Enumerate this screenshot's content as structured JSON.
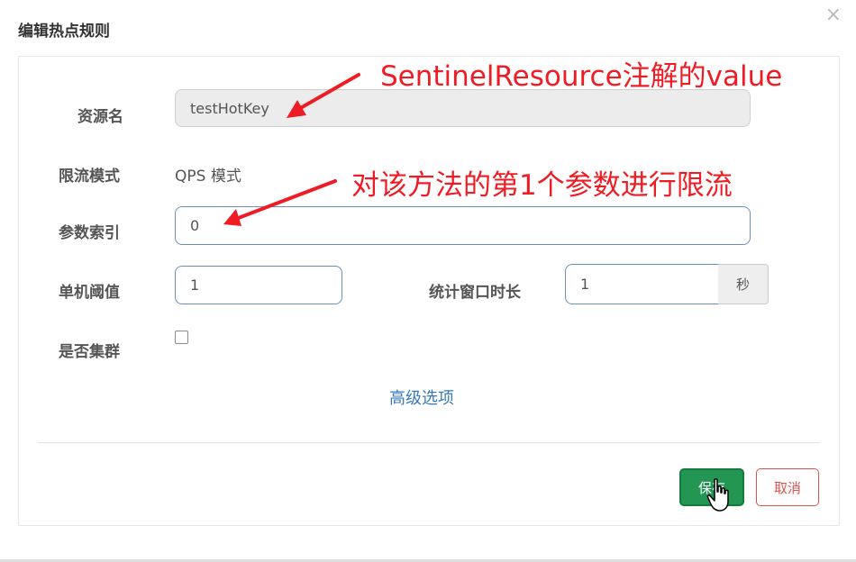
{
  "dialog": {
    "title": "编辑热点规则",
    "close_icon": "close-icon"
  },
  "form": {
    "resource_name": {
      "label": "资源名",
      "value": "testHotKey"
    },
    "limit_mode": {
      "label": "限流模式",
      "value": "QPS 模式"
    },
    "param_index": {
      "label": "参数索引",
      "value": "0"
    },
    "threshold": {
      "label": "单机阈值",
      "value": "1"
    },
    "window": {
      "label": "统计窗口时长",
      "value": "1",
      "unit": "秒"
    },
    "cluster": {
      "label": "是否集群",
      "checked": false
    },
    "advanced_link": "高级选项"
  },
  "buttons": {
    "save": "保存",
    "cancel": "取消"
  },
  "annotations": {
    "resource_note": "SentinelResource注解的value",
    "param_note": "对该方法的第1个参数进行限流",
    "color": "#ee1c24"
  },
  "colors": {
    "save_bg": "#229652",
    "cancel_border": "#d9534f",
    "link": "#3a79b8",
    "input_border": "#6c8fb8"
  }
}
